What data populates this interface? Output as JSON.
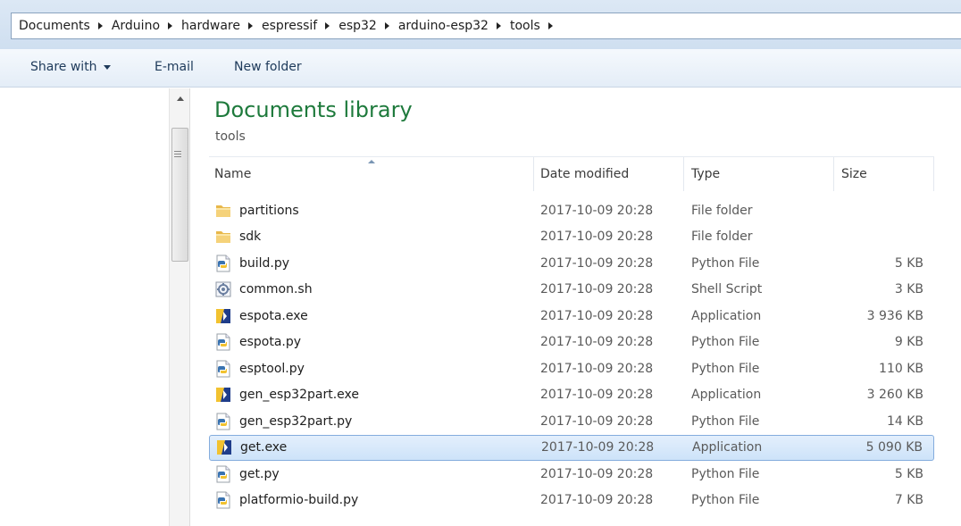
{
  "breadcrumb": [
    "Documents",
    "Arduino",
    "hardware",
    "espressif",
    "esp32",
    "arduino-esp32",
    "tools"
  ],
  "toolbar": {
    "share_with": "Share with",
    "email": "E-mail",
    "new_folder": "New folder"
  },
  "library": {
    "title": "Documents library",
    "subtitle": "tools"
  },
  "columns": {
    "name": "Name",
    "date": "Date modified",
    "type": "Type",
    "size": "Size"
  },
  "files": [
    {
      "name": "partitions",
      "date": "2017-10-09 20:28",
      "type": "File folder",
      "size": "",
      "icon": "folder-icon"
    },
    {
      "name": "sdk",
      "date": "2017-10-09 20:28",
      "type": "File folder",
      "size": "",
      "icon": "folder-icon"
    },
    {
      "name": "build.py",
      "date": "2017-10-09 20:28",
      "type": "Python File",
      "size": "5 KB",
      "icon": "python-file-icon"
    },
    {
      "name": "common.sh",
      "date": "2017-10-09 20:28",
      "type": "Shell Script",
      "size": "3 KB",
      "icon": "shell-script-icon"
    },
    {
      "name": "espota.exe",
      "date": "2017-10-09 20:28",
      "type": "Application",
      "size": "3 936 KB",
      "icon": "application-icon"
    },
    {
      "name": "espota.py",
      "date": "2017-10-09 20:28",
      "type": "Python File",
      "size": "9 KB",
      "icon": "python-file-icon"
    },
    {
      "name": "esptool.py",
      "date": "2017-10-09 20:28",
      "type": "Python File",
      "size": "110 KB",
      "icon": "python-file-icon"
    },
    {
      "name": "gen_esp32part.exe",
      "date": "2017-10-09 20:28",
      "type": "Application",
      "size": "3 260 KB",
      "icon": "application-icon"
    },
    {
      "name": "gen_esp32part.py",
      "date": "2017-10-09 20:28",
      "type": "Python File",
      "size": "14 KB",
      "icon": "python-file-icon"
    },
    {
      "name": "get.exe",
      "date": "2017-10-09 20:28",
      "type": "Application",
      "size": "5 090 KB",
      "icon": "application-icon",
      "selected": true
    },
    {
      "name": "get.py",
      "date": "2017-10-09 20:28",
      "type": "Python File",
      "size": "5 KB",
      "icon": "python-file-icon"
    },
    {
      "name": "platformio-build.py",
      "date": "2017-10-09 20:28",
      "type": "Python File",
      "size": "7 KB",
      "icon": "python-file-icon"
    }
  ],
  "colors": {
    "library_title": "#1e7a3c",
    "selection_border": "#84acdd",
    "selection_fill": "#cde3f9"
  }
}
